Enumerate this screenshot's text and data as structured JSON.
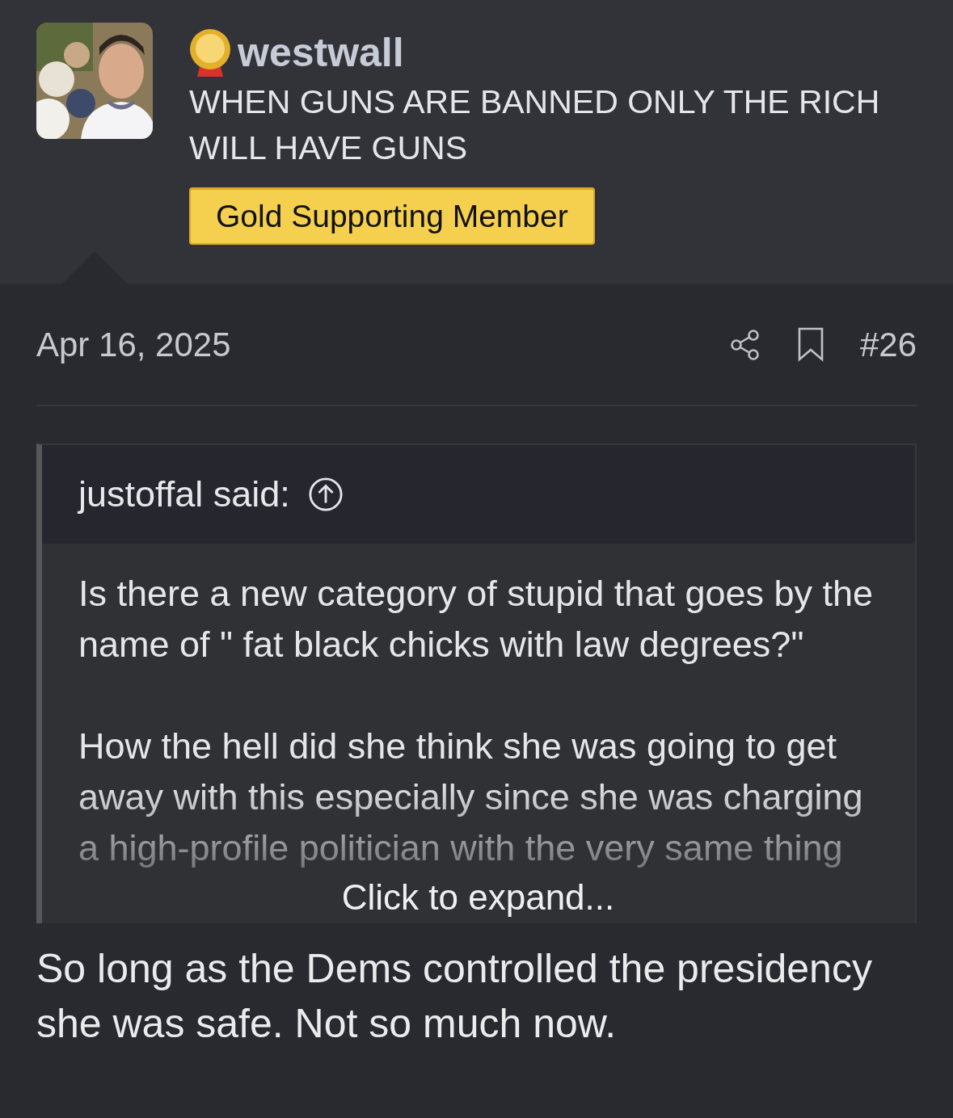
{
  "author": {
    "username": "westwall",
    "title": "WHEN GUNS ARE BANNED ONLY THE RICH WILL HAVE GUNS",
    "banner": "Gold Supporting Member"
  },
  "post": {
    "date": "Apr 16, 2025",
    "number": "#26"
  },
  "quote": {
    "author": "justoffal said:",
    "paragraphs": [
      "Is there a new category of stupid that goes by the name of \" fat black chicks with law degrees?\"",
      "How the hell did she think she was going to get away with this especially since she was charging a high-profile politician with the very same thing"
    ],
    "expand_label": "Click to expand..."
  },
  "message": "So long as the Dems controlled the presidency she was safe. Not so much now."
}
